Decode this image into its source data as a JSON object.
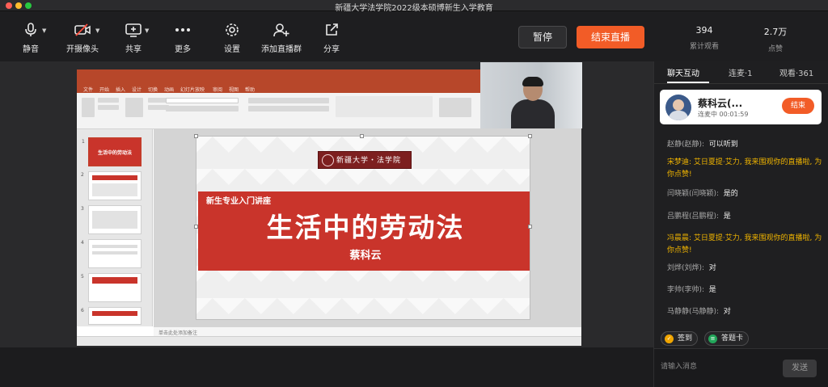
{
  "window": {
    "title": "新疆大学法学院2022级本硕博新生入学教育"
  },
  "toolbar": {
    "mute_label": "静音",
    "camera_label": "开摄像头",
    "share_label": "共享",
    "more_label": "更多",
    "settings_label": "设置",
    "add_group_label": "添加直播群",
    "share_out_label": "分享",
    "pause_label": "暂停",
    "end_live_label": "结束直播",
    "viewers_count": "394",
    "viewers_label": "累计观看",
    "likes_count": "2.7万",
    "likes_label": "点赞"
  },
  "slide": {
    "logo_text": "新疆大学・法学院",
    "subtitle": "新生专业入门讲座",
    "title": "生活中的劳动法",
    "presenter": "蔡科云",
    "thumb1_title": "生活中的劳动法",
    "notes_placeholder": "单击此处添加备注",
    "ppt_tabs": [
      "文件",
      "开始",
      "插入",
      "设计",
      "切换",
      "动画",
      "幻灯片放映",
      "审阅",
      "视图",
      "帮助"
    ],
    "thumb_numbers": [
      "1",
      "2",
      "3",
      "4",
      "5",
      "6"
    ]
  },
  "panel": {
    "tab_chat": "聊天互动",
    "tab_link": "连麦·1",
    "tab_watch": "观看·361",
    "cohost_name": "蔡科云(...",
    "cohost_status": "连麦中 00:01:59",
    "cohost_end": "结束",
    "messages": [
      {
        "who": "赵静(赵静):",
        "text": "可以听到"
      },
      {
        "sys": "宋梦迪: 艾日夏提·艾力, 我来围观你的直播啦, 为你点赞!"
      },
      {
        "who": "闫晓颖(闫晓颖):",
        "text": "是的"
      },
      {
        "who": "吕鹏程(吕鹏程):",
        "text": "是"
      },
      {
        "sys": "冯晨晨: 艾日夏提·艾力, 我来围观你的直播啦, 为你点赞!"
      },
      {
        "who": "刘烨(刘烨):",
        "text": "对"
      },
      {
        "who": "李帅(李帅):",
        "text": "是"
      },
      {
        "who": "马静静(马静静):",
        "text": "对"
      }
    ],
    "signin_label": "签到",
    "answer_card_label": "答题卡",
    "input_placeholder": "请输入消息",
    "send_label": "发送"
  },
  "colors": {
    "accent": "#f25c27",
    "system_msg": "#f0b400",
    "ppt_red": "#c9342b"
  }
}
